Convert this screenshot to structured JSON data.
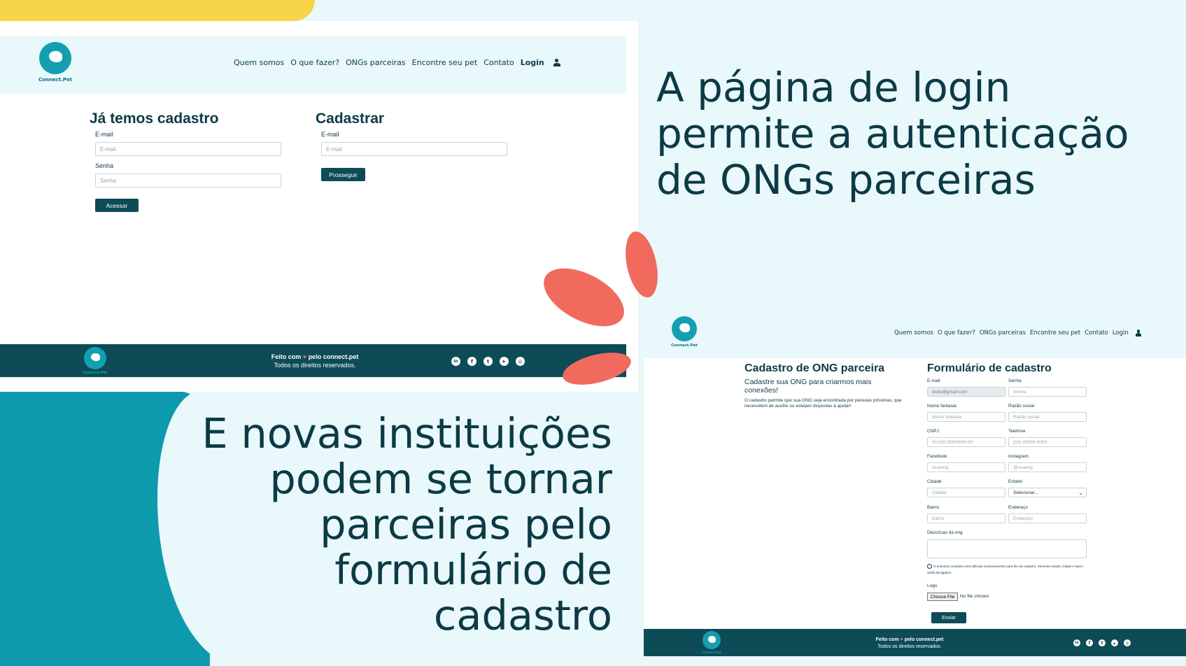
{
  "site": {
    "logo_text": "Connect.Pet",
    "nav_items": [
      "Quem somos",
      "O que fazer?",
      "ONGs parceiras",
      "Encontre seu pet",
      "Contato",
      "Login"
    ]
  },
  "login_page": {
    "existing": {
      "title": "Já temos cadastro",
      "email_label": "E-mail",
      "email_placeholder": "E-mail",
      "password_label": "Senha",
      "password_placeholder": "Senha",
      "submit_label": "Acessar"
    },
    "register": {
      "title": "Cadastrar",
      "email_label": "E-mail",
      "email_placeholder": "E-mail",
      "submit_label": "Prosseguir"
    }
  },
  "footer": {
    "made_with_prefix": "Feito com",
    "heart": "♥",
    "made_with_suffix": "pelo connect.pet",
    "rights": "Todos os direitos reservados.",
    "social_icons": [
      "linkedin-icon",
      "facebook-icon",
      "twitter-icon",
      "youtube-icon",
      "instagram-icon"
    ],
    "social_glyphs": [
      "in",
      "f",
      "t",
      "▶",
      "◎"
    ]
  },
  "captions": {
    "login": "A página de login permite a autenticação de ONGs parceiras",
    "register": "E novas instituições podem se tornar parceiras pelo formulário de cadastro"
  },
  "register_page": {
    "intro_title": "Cadastro de ONG parceira",
    "intro_subtitle": "Cadastre sua ONG para criarmos mais conexões!",
    "intro_text": "O cadastro permite que sua ONG seja encontrada por pessoas próximas, que necessitem de auxílio ou estejam dispostas a ajudar!",
    "form_title": "Formulário de cadastro",
    "fields": {
      "email_label": "E-mail",
      "email_value": "teste@gmail.com",
      "senha_label": "Senha",
      "senha_placeholder": "Senha",
      "fantasia_label": "Nome fantasia",
      "fantasia_placeholder": "Nome fantasia",
      "razao_label": "Razão social",
      "razao_placeholder": "Razão social",
      "cnpj_label": "CNPJ",
      "cnpj_placeholder": "00.000.000/0000-00",
      "telefone_label": "Telefone",
      "telefone_placeholder": "(00) 00000-0000",
      "facebook_label": "Facebook",
      "facebook_placeholder": "/suaong",
      "instagram_label": "Instagram",
      "instagram_placeholder": "@suaong",
      "cidade_label": "Cidade",
      "cidade_placeholder": "Cidade",
      "estado_label": "Estado",
      "estado_value": "Selecionar...",
      "bairro_label": "Bairro",
      "bairro_placeholder": "Bairro",
      "endereco_label": "Endereço",
      "endereco_placeholder": "Endereço",
      "descricao_label": "Descricao da ong",
      "address_note": "O endereço completo será utilizado exclusivamente para fins de cadastro. Somente estado, cidade e bairro serão divulgados.",
      "logo_label": "Logo",
      "file_button": "Choose File",
      "file_status": "No file chosen",
      "submit_label": "Enviar"
    }
  },
  "colors": {
    "primary_dark": "#0d4b57",
    "brand_teal": "#149fb0",
    "background": "#e9f8fb",
    "accent_coral": "#f06a5e",
    "accent_yellow": "#f7d548"
  }
}
